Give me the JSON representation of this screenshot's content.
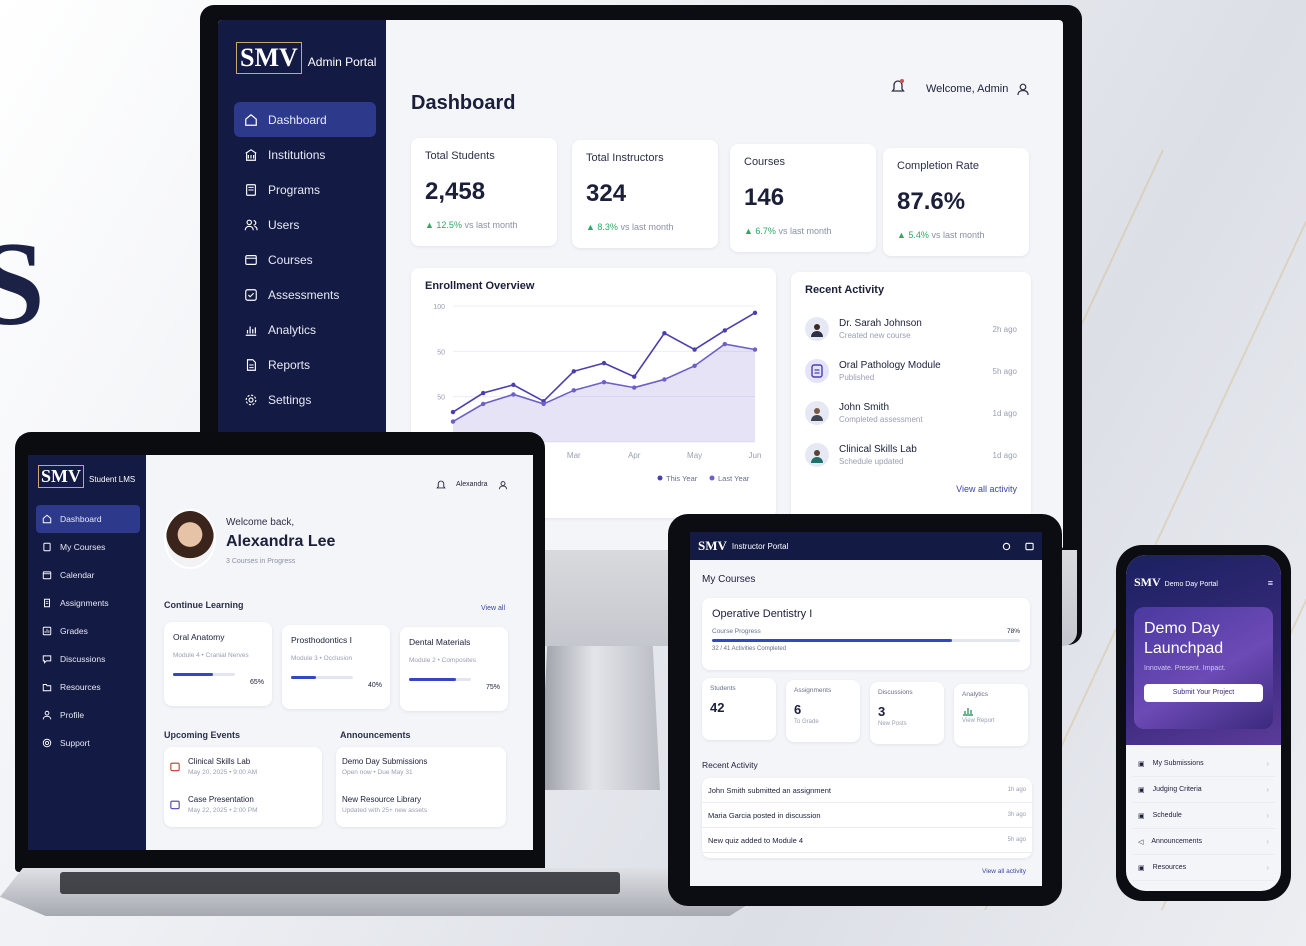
{
  "background": {
    "partial_text": "S"
  },
  "colors": {
    "navy": "#131a44",
    "accent": "#3347c4",
    "active_nav": "#2d3a8c",
    "positive": "#2fa864"
  },
  "admin": {
    "logo_brand": "SMV",
    "logo_sub": "Admin Portal",
    "nav": [
      {
        "label": "Dashboard",
        "icon": "home-icon"
      },
      {
        "label": "Institutions",
        "icon": "building-icon"
      },
      {
        "label": "Programs",
        "icon": "book-icon"
      },
      {
        "label": "Users",
        "icon": "users-icon"
      },
      {
        "label": "Courses",
        "icon": "courses-icon"
      },
      {
        "label": "Assessments",
        "icon": "check-icon"
      },
      {
        "label": "Analytics",
        "icon": "chart-icon"
      },
      {
        "label": "Reports",
        "icon": "report-icon"
      },
      {
        "label": "Settings",
        "icon": "gear-icon"
      }
    ],
    "page_title": "Dashboard",
    "welcome": "Welcome, Admin",
    "stats": [
      {
        "label": "Total Students",
        "value": "2,458",
        "delta": "12.5%",
        "suffix": "vs last month"
      },
      {
        "label": "Total Instructors",
        "value": "324",
        "delta": "8.3%",
        "suffix": "vs last month"
      },
      {
        "label": "Courses",
        "value": "146",
        "delta": "6.7%",
        "suffix": "vs last month"
      },
      {
        "label": "Completion Rate",
        "value": "87.6%",
        "delta": "5.4%",
        "suffix": "vs last month"
      }
    ],
    "recent": {
      "title": "Recent Activity",
      "items": [
        {
          "name": "Dr. Sarah Johnson",
          "sub": "Created new course",
          "time": "2h ago"
        },
        {
          "name": "Oral Pathology Module",
          "sub": "Published",
          "time": "5h ago"
        },
        {
          "name": "John Smith",
          "sub": "Completed assessment",
          "time": "1d ago"
        },
        {
          "name": "Clinical Skills Lab",
          "sub": "Schedule updated",
          "time": "1d ago"
        }
      ],
      "view_all": "View all activity"
    }
  },
  "chart_data": {
    "type": "line",
    "title": "Enrollment Overview",
    "y_ticks": [
      "100",
      "50",
      "50",
      "0"
    ],
    "x": [
      "Mar",
      "Apr",
      "May",
      "Jun"
    ],
    "ylim": [
      0,
      100
    ],
    "series": [
      {
        "name": "This Year",
        "x": [
          0,
          0.5,
          1,
          1.5,
          2,
          2.5,
          3,
          3.5,
          4,
          4.5,
          5
        ],
        "values": [
          22,
          36,
          42,
          30,
          52,
          58,
          48,
          80,
          68,
          82,
          95
        ],
        "color": "#4a3fb0"
      },
      {
        "name": "Last Year",
        "x": [
          0,
          0.5,
          1,
          1.5,
          2,
          2.5,
          3,
          3.5,
          4,
          4.5,
          5
        ],
        "values": [
          15,
          28,
          35,
          28,
          38,
          44,
          40,
          46,
          56,
          72,
          68
        ],
        "color": "#6b5fc8"
      }
    ],
    "legend": "bottom-right",
    "grid": true
  },
  "student": {
    "logo_brand": "SMV",
    "logo_sub": "Student LMS",
    "nav": [
      {
        "label": "Dashboard"
      },
      {
        "label": "My Courses"
      },
      {
        "label": "Calendar"
      },
      {
        "label": "Assignments"
      },
      {
        "label": "Grades"
      },
      {
        "label": "Discussions"
      },
      {
        "label": "Resources"
      },
      {
        "label": "Profile"
      },
      {
        "label": "Support"
      }
    ],
    "user_label": "Alexandra",
    "greeting": "Welcome back,",
    "name": "Alexandra Lee",
    "sub": "3 Courses in Progress",
    "continue_title": "Continue Learning",
    "view_all": "View all",
    "courses": [
      {
        "name": "Oral Anatomy",
        "module": "Module 4 • Cranial Nerves",
        "progress": 0.65,
        "pct": "65%"
      },
      {
        "name": "Prosthodontics I",
        "module": "Module 3 • Occlusion",
        "progress": 0.4,
        "pct": "40%"
      },
      {
        "name": "Dental Materials",
        "module": "Module 2 • Composites",
        "progress": 0.75,
        "pct": "75%"
      }
    ],
    "events_title": "Upcoming Events",
    "events": [
      {
        "name": "Clinical Skills Lab",
        "when": "May 20, 2025 • 9:00 AM"
      },
      {
        "name": "Case Presentation",
        "when": "May 22, 2025 • 2:00 PM"
      }
    ],
    "announcements_title": "Announcements",
    "announcements": [
      {
        "name": "Demo Day Submissions",
        "sub": "Open now • Due May 31"
      },
      {
        "name": "New Resource Library",
        "sub": "Updated with 25+ new assets"
      }
    ]
  },
  "instructor": {
    "logo_brand": "SMV",
    "logo_sub": "Instructor Portal",
    "section": "My Courses",
    "course": "Operative Dentistry I",
    "progress_label": "Course Progress",
    "progress": 0.78,
    "progress_pct": "78%",
    "progress_sub": "32 / 41 Activities Completed",
    "stats": [
      {
        "label": "Students",
        "value": "42",
        "sub": ""
      },
      {
        "label": "Assignments",
        "value": "6",
        "sub": "To Grade"
      },
      {
        "label": "Discussions",
        "value": "3",
        "sub": "New Posts"
      },
      {
        "label": "Analytics",
        "value": "",
        "sub": "View Report"
      }
    ],
    "recent_title": "Recent Activity",
    "recent": [
      {
        "text": "John Smith submitted an assignment",
        "time": "1h ago"
      },
      {
        "text": "Maria Garcia posted in discussion",
        "time": "3h ago"
      },
      {
        "text": "New quiz added to Module 4",
        "time": "5h ago"
      }
    ],
    "view_all": "View all activity"
  },
  "phone": {
    "logo_brand": "SMV",
    "logo_sub": "Demo Day Portal",
    "hero_title": "Demo Day Launchpad",
    "hero_sub": "Innovate. Present. Impact.",
    "cta": "Submit Your Project",
    "menu": [
      {
        "label": "My Submissions"
      },
      {
        "label": "Judging Criteria"
      },
      {
        "label": "Schedule"
      },
      {
        "label": "Announcements"
      },
      {
        "label": "Resources"
      }
    ]
  }
}
